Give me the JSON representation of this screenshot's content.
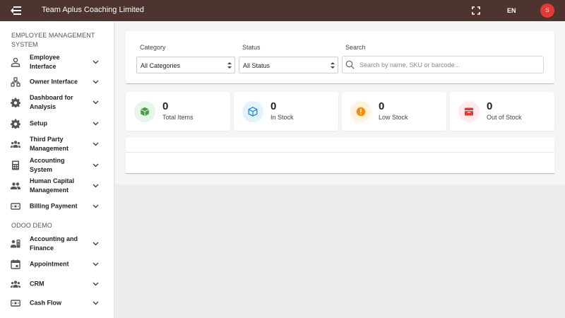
{
  "header": {
    "title": "Team Aplus Coaching Limited",
    "language": "EN",
    "avatar_initial": "S",
    "menu_icon": "menu-collapse-icon",
    "fullscreen_icon": "fullscreen-icon"
  },
  "sidebar": {
    "sections": [
      {
        "title": "EMPLOYEE MANAGEMENT SYSTEM",
        "items": [
          {
            "label": "Employee Interface",
            "icon": "person-icon"
          },
          {
            "label": "Owner Interface",
            "icon": "org-chart-icon"
          },
          {
            "label": "Dashboard for Analysis",
            "icon": "gear-icon"
          },
          {
            "label": "Setup",
            "icon": "gear-icon"
          },
          {
            "label": "Third Party Management",
            "icon": "group-icon"
          },
          {
            "label": "Accounting System",
            "icon": "calculator-icon"
          },
          {
            "label": "Human Capital Management",
            "icon": "group-icon"
          },
          {
            "label": "Billing Payment",
            "icon": "payment-icon"
          }
        ]
      },
      {
        "title": "ODOO DEMO",
        "items": [
          {
            "label": "Accounting and Finance",
            "icon": "finance-icon"
          },
          {
            "label": "Appointment",
            "icon": "calendar-icon"
          },
          {
            "label": "CRM",
            "icon": "group-icon"
          },
          {
            "label": "Cash Flow",
            "icon": "payment-icon"
          }
        ]
      }
    ]
  },
  "filters": {
    "category": {
      "label": "Category",
      "value": "All Categories"
    },
    "status": {
      "label": "Status",
      "value": "All Status"
    },
    "search": {
      "label": "Search",
      "placeholder": "Search by name, SKU or barcode...",
      "value": ""
    }
  },
  "stats": [
    {
      "value": "0",
      "label": "Total Items",
      "icon": "package-icon",
      "color": "#43a047",
      "bg": "#e8f5e9"
    },
    {
      "value": "0",
      "label": "In Stock",
      "icon": "package-icon",
      "color": "#1e88e5",
      "bg": "#e3f2fd"
    },
    {
      "value": "0",
      "label": "Low Stock",
      "icon": "warning-icon",
      "color": "#fb8c00",
      "bg": "#fff3e0"
    },
    {
      "value": "0",
      "label": "Out of Stock",
      "icon": "empty-box-icon",
      "color": "#e53935",
      "bg": "#ffebee"
    }
  ],
  "colors": {
    "topbar": "#4e342e",
    "avatar": "#e53935"
  }
}
